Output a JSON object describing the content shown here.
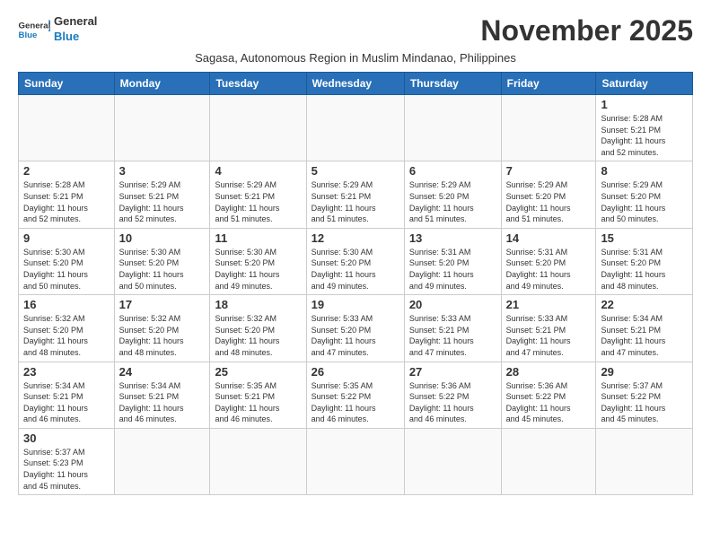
{
  "header": {
    "logo_general": "General",
    "logo_blue": "Blue",
    "month_title": "November 2025",
    "subtitle": "Sagasa, Autonomous Region in Muslim Mindanao, Philippines"
  },
  "days_of_week": [
    "Sunday",
    "Monday",
    "Tuesday",
    "Wednesday",
    "Thursday",
    "Friday",
    "Saturday"
  ],
  "weeks": [
    [
      {
        "day": "",
        "info": ""
      },
      {
        "day": "",
        "info": ""
      },
      {
        "day": "",
        "info": ""
      },
      {
        "day": "",
        "info": ""
      },
      {
        "day": "",
        "info": ""
      },
      {
        "day": "",
        "info": ""
      },
      {
        "day": "1",
        "info": "Sunrise: 5:28 AM\nSunset: 5:21 PM\nDaylight: 11 hours\nand 52 minutes."
      }
    ],
    [
      {
        "day": "2",
        "info": "Sunrise: 5:28 AM\nSunset: 5:21 PM\nDaylight: 11 hours\nand 52 minutes."
      },
      {
        "day": "3",
        "info": "Sunrise: 5:29 AM\nSunset: 5:21 PM\nDaylight: 11 hours\nand 52 minutes."
      },
      {
        "day": "4",
        "info": "Sunrise: 5:29 AM\nSunset: 5:21 PM\nDaylight: 11 hours\nand 51 minutes."
      },
      {
        "day": "5",
        "info": "Sunrise: 5:29 AM\nSunset: 5:21 PM\nDaylight: 11 hours\nand 51 minutes."
      },
      {
        "day": "6",
        "info": "Sunrise: 5:29 AM\nSunset: 5:20 PM\nDaylight: 11 hours\nand 51 minutes."
      },
      {
        "day": "7",
        "info": "Sunrise: 5:29 AM\nSunset: 5:20 PM\nDaylight: 11 hours\nand 51 minutes."
      },
      {
        "day": "8",
        "info": "Sunrise: 5:29 AM\nSunset: 5:20 PM\nDaylight: 11 hours\nand 50 minutes."
      }
    ],
    [
      {
        "day": "9",
        "info": "Sunrise: 5:30 AM\nSunset: 5:20 PM\nDaylight: 11 hours\nand 50 minutes."
      },
      {
        "day": "10",
        "info": "Sunrise: 5:30 AM\nSunset: 5:20 PM\nDaylight: 11 hours\nand 50 minutes."
      },
      {
        "day": "11",
        "info": "Sunrise: 5:30 AM\nSunset: 5:20 PM\nDaylight: 11 hours\nand 49 minutes."
      },
      {
        "day": "12",
        "info": "Sunrise: 5:30 AM\nSunset: 5:20 PM\nDaylight: 11 hours\nand 49 minutes."
      },
      {
        "day": "13",
        "info": "Sunrise: 5:31 AM\nSunset: 5:20 PM\nDaylight: 11 hours\nand 49 minutes."
      },
      {
        "day": "14",
        "info": "Sunrise: 5:31 AM\nSunset: 5:20 PM\nDaylight: 11 hours\nand 49 minutes."
      },
      {
        "day": "15",
        "info": "Sunrise: 5:31 AM\nSunset: 5:20 PM\nDaylight: 11 hours\nand 48 minutes."
      }
    ],
    [
      {
        "day": "16",
        "info": "Sunrise: 5:32 AM\nSunset: 5:20 PM\nDaylight: 11 hours\nand 48 minutes."
      },
      {
        "day": "17",
        "info": "Sunrise: 5:32 AM\nSunset: 5:20 PM\nDaylight: 11 hours\nand 48 minutes."
      },
      {
        "day": "18",
        "info": "Sunrise: 5:32 AM\nSunset: 5:20 PM\nDaylight: 11 hours\nand 48 minutes."
      },
      {
        "day": "19",
        "info": "Sunrise: 5:33 AM\nSunset: 5:20 PM\nDaylight: 11 hours\nand 47 minutes."
      },
      {
        "day": "20",
        "info": "Sunrise: 5:33 AM\nSunset: 5:21 PM\nDaylight: 11 hours\nand 47 minutes."
      },
      {
        "day": "21",
        "info": "Sunrise: 5:33 AM\nSunset: 5:21 PM\nDaylight: 11 hours\nand 47 minutes."
      },
      {
        "day": "22",
        "info": "Sunrise: 5:34 AM\nSunset: 5:21 PM\nDaylight: 11 hours\nand 47 minutes."
      }
    ],
    [
      {
        "day": "23",
        "info": "Sunrise: 5:34 AM\nSunset: 5:21 PM\nDaylight: 11 hours\nand 46 minutes."
      },
      {
        "day": "24",
        "info": "Sunrise: 5:34 AM\nSunset: 5:21 PM\nDaylight: 11 hours\nand 46 minutes."
      },
      {
        "day": "25",
        "info": "Sunrise: 5:35 AM\nSunset: 5:21 PM\nDaylight: 11 hours\nand 46 minutes."
      },
      {
        "day": "26",
        "info": "Sunrise: 5:35 AM\nSunset: 5:22 PM\nDaylight: 11 hours\nand 46 minutes."
      },
      {
        "day": "27",
        "info": "Sunrise: 5:36 AM\nSunset: 5:22 PM\nDaylight: 11 hours\nand 46 minutes."
      },
      {
        "day": "28",
        "info": "Sunrise: 5:36 AM\nSunset: 5:22 PM\nDaylight: 11 hours\nand 45 minutes."
      },
      {
        "day": "29",
        "info": "Sunrise: 5:37 AM\nSunset: 5:22 PM\nDaylight: 11 hours\nand 45 minutes."
      }
    ],
    [
      {
        "day": "30",
        "info": "Sunrise: 5:37 AM\nSunset: 5:23 PM\nDaylight: 11 hours\nand 45 minutes."
      },
      {
        "day": "",
        "info": ""
      },
      {
        "day": "",
        "info": ""
      },
      {
        "day": "",
        "info": ""
      },
      {
        "day": "",
        "info": ""
      },
      {
        "day": "",
        "info": ""
      },
      {
        "day": "",
        "info": ""
      }
    ]
  ]
}
